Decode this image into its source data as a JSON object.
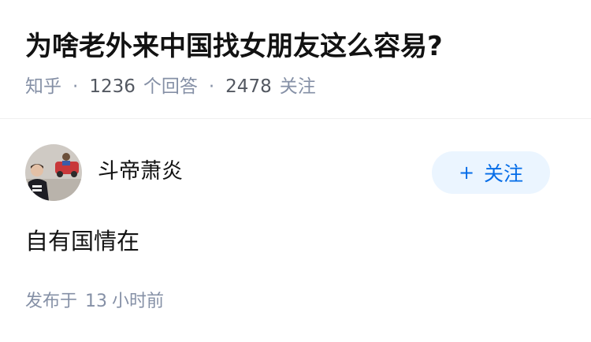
{
  "question": {
    "title": "为啥老外来中国找女朋友这么容易?",
    "source": "知乎",
    "answer_count": "1236",
    "answer_count_label": "个回答",
    "follower_count": "2478",
    "follower_count_label": "关注",
    "separator": "·"
  },
  "answer": {
    "author_name": "斗帝萧炎",
    "follow_button_label": "关注",
    "follow_button_icon": "+",
    "content": "自有国情在",
    "time_prefix": "发布于",
    "time_value": "13",
    "time_suffix": "小时前"
  },
  "colors": {
    "meta_gray": "#8590a6",
    "follow_blue": "#056de8",
    "follow_bg": "#ebf5ff"
  }
}
